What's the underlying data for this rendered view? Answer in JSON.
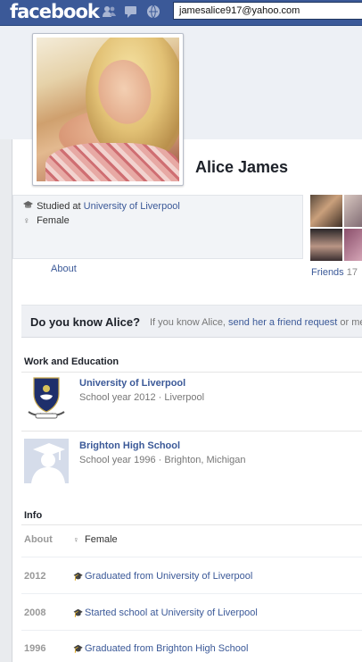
{
  "header": {
    "logo": "facebook",
    "search_value": "jamesalice917@yahoo.com",
    "icons": [
      "friends-icon",
      "messages-icon",
      "notifications-icon"
    ]
  },
  "profile": {
    "name": "Alice James",
    "intro": {
      "studied_prefix": "Studied at ",
      "studied_school": "University of Liverpool",
      "gender": "Female"
    },
    "about_link": "About",
    "friends_label": "Friends",
    "friends_count": "17"
  },
  "know": {
    "title": "Do you know Alice?",
    "text_prefix": "If you know Alice, ",
    "link": "send her a friend request",
    "text_suffix": " or me"
  },
  "work_education": {
    "title": "Work and Education",
    "items": [
      {
        "name": "University of Liverpool",
        "detail": "School year 2012 · Liverpool"
      },
      {
        "name": "Brighton High School",
        "detail": "School year 1996 · Brighton, Michigan"
      }
    ]
  },
  "info": {
    "title": "Info",
    "rows": [
      {
        "label": "About",
        "value": "Female"
      },
      {
        "label": "2012",
        "value": "Graduated from University of Liverpool"
      },
      {
        "label": "2008",
        "value": "Started school at University of Liverpool"
      },
      {
        "label": "1996",
        "value": "Graduated from Brighton High School"
      }
    ]
  },
  "colors": {
    "brand": "#3b5998",
    "background": "#e9ebee"
  }
}
